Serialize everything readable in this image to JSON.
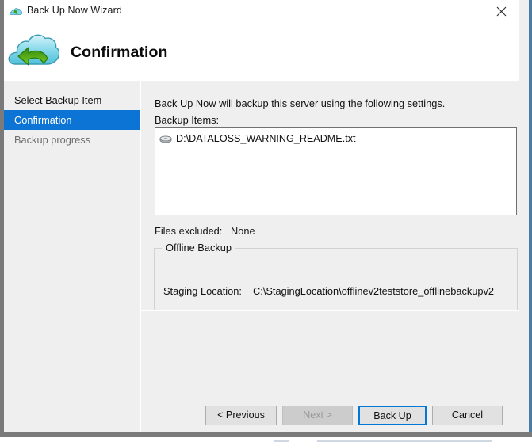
{
  "window": {
    "title": "Back Up Now Wizard",
    "title_icon": "cloud-backup-icon",
    "close_icon": "close-icon"
  },
  "header": {
    "icon": "cloud-backup-large-icon",
    "title": "Confirmation"
  },
  "sidebar": {
    "items": [
      {
        "label": "Select Backup Item",
        "state": "done"
      },
      {
        "label": "Confirmation",
        "state": "active"
      },
      {
        "label": "Backup progress",
        "state": "todo"
      }
    ]
  },
  "main": {
    "intro": "Back Up Now will backup this server using the following settings.",
    "backup_items_label": "Backup Items:",
    "backup_items": [
      {
        "icon": "disk-drive-icon",
        "path": "D:\\DATALOSS_WARNING_README.txt"
      }
    ],
    "files_excluded_label": "Files excluded:",
    "files_excluded_value": "None",
    "offline_group": {
      "legend": "Offline Backup",
      "staging_location_label": "Staging Location:",
      "staging_location_value": "C:\\StagingLocation\\offlinev2teststore_offlinebackupv2"
    }
  },
  "footer": {
    "buttons": [
      {
        "label": "< Previous",
        "state": "enabled"
      },
      {
        "label": "Next >",
        "state": "disabled"
      },
      {
        "label": "Back Up",
        "state": "default"
      },
      {
        "label": "Cancel",
        "state": "enabled"
      }
    ]
  },
  "colors": {
    "accent": "#0c74d4",
    "default_button_border": "#0078d7",
    "window_chrome": "#efefef",
    "frame": "#7a7a7a"
  }
}
